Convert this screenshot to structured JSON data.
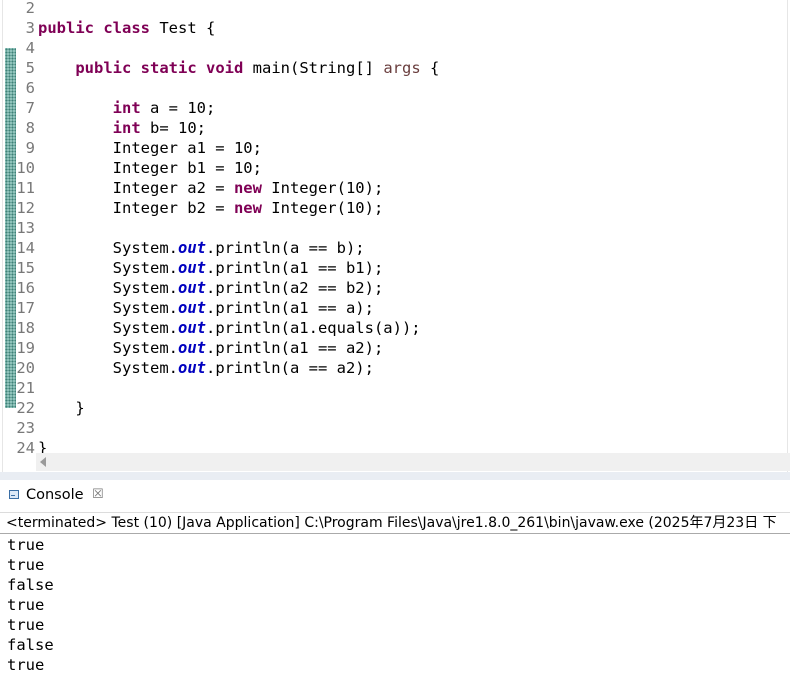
{
  "editor": {
    "lines": [
      {
        "n": "2",
        "t": []
      },
      {
        "n": "3",
        "t": [
          [
            "kw",
            "public"
          ],
          [
            "",
            "⁠ "
          ],
          [
            "kw",
            "class"
          ],
          [
            "",
            " Test {"
          ]
        ]
      },
      {
        "n": "4",
        "t": []
      },
      {
        "n": "5",
        "t": [
          [
            "",
            "    "
          ],
          [
            "kw",
            "public"
          ],
          [
            "",
            " "
          ],
          [
            "kw",
            "static"
          ],
          [
            "",
            " "
          ],
          [
            "kw",
            "void"
          ],
          [
            "",
            " main(String[] "
          ],
          [
            "par",
            "args"
          ],
          [
            "",
            " {"
          ]
        ]
      },
      {
        "n": "6",
        "t": []
      },
      {
        "n": "7",
        "t": [
          [
            "",
            "        "
          ],
          [
            "kw",
            "int"
          ],
          [
            "",
            " a = 10;"
          ]
        ]
      },
      {
        "n": "8",
        "t": [
          [
            "",
            "        "
          ],
          [
            "kw",
            "int"
          ],
          [
            "",
            " b= 10;"
          ]
        ]
      },
      {
        "n": "9",
        "t": [
          [
            "",
            "        Integer a1 = 10;"
          ]
        ]
      },
      {
        "n": "10",
        "t": [
          [
            "",
            "        Integer b1 = 10;"
          ]
        ]
      },
      {
        "n": "11",
        "t": [
          [
            "",
            "        Integer a2 = "
          ],
          [
            "kw",
            "new"
          ],
          [
            "",
            " Integer(10);"
          ]
        ]
      },
      {
        "n": "12",
        "t": [
          [
            "",
            "        Integer b2 = "
          ],
          [
            "kw",
            "new"
          ],
          [
            "",
            " Integer(10);"
          ]
        ]
      },
      {
        "n": "13",
        "t": []
      },
      {
        "n": "14",
        "t": [
          [
            "",
            "        System."
          ],
          [
            "fld",
            "out"
          ],
          [
            "",
            ".println(a == b);"
          ]
        ]
      },
      {
        "n": "15",
        "t": [
          [
            "",
            "        System."
          ],
          [
            "fld",
            "out"
          ],
          [
            "",
            ".println(a1 == b1);"
          ]
        ]
      },
      {
        "n": "16",
        "t": [
          [
            "",
            "        System."
          ],
          [
            "fld",
            "out"
          ],
          [
            "",
            ".println(a2 == b2);"
          ]
        ]
      },
      {
        "n": "17",
        "t": [
          [
            "",
            "        System."
          ],
          [
            "fld",
            "out"
          ],
          [
            "",
            ".println(a1 == a);"
          ]
        ]
      },
      {
        "n": "18",
        "t": [
          [
            "",
            "        System."
          ],
          [
            "fld",
            "out"
          ],
          [
            "",
            ".println(a1.equals(a));"
          ]
        ]
      },
      {
        "n": "19",
        "t": [
          [
            "",
            "        System."
          ],
          [
            "fld",
            "out"
          ],
          [
            "",
            ".println(a1 == a2);"
          ]
        ]
      },
      {
        "n": "20",
        "t": [
          [
            "",
            "        System."
          ],
          [
            "fld",
            "out"
          ],
          [
            "",
            ".println(a == a2);"
          ]
        ]
      },
      {
        "n": "21",
        "t": []
      },
      {
        "n": "22",
        "t": [
          [
            "",
            "    }"
          ]
        ]
      },
      {
        "n": "23",
        "t": []
      },
      {
        "n": "24",
        "t": [
          [
            "",
            "}"
          ]
        ]
      }
    ]
  },
  "console": {
    "tab_label": "Console",
    "close_glyph": "☒",
    "status": "<terminated> Test (10) [Java Application] C:\\Program Files\\Java\\jre1.8.0_261\\bin\\javaw.exe (2025年7月23日 下",
    "output": [
      "true",
      "true",
      "false",
      "true",
      "true",
      "false",
      "true"
    ]
  },
  "colors": {
    "keyword": "#7f0055",
    "field": "#0000c0",
    "parameter": "#6a3e3e",
    "line_number": "#787878",
    "change_ruler": "#8fc3bb"
  }
}
